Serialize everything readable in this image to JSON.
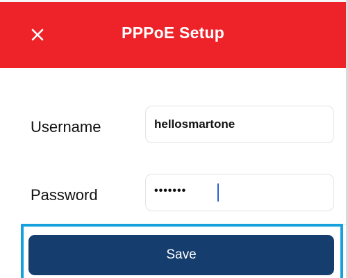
{
  "header": {
    "title": "PPPoE Setup",
    "close_icon": "close-icon",
    "background_color": "#ee2329"
  },
  "form": {
    "username_label": "Username",
    "username_value": "hellosmartone",
    "password_label": "Password",
    "password_masked": "•••••••"
  },
  "actions": {
    "save_label": "Save",
    "save_color": "#153e6e",
    "highlight_color": "#14a1dd"
  }
}
